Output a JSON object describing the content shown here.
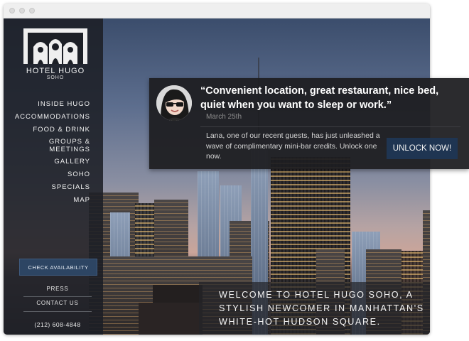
{
  "sidebar": {
    "brand": "HOTEL HUGO",
    "brand_sub": "SOHO",
    "nav": [
      {
        "label": "INSIDE HUGO"
      },
      {
        "label": "ACCOMMODATIONS"
      },
      {
        "label": "FOOD & DRINK"
      },
      {
        "label": "GROUPS &",
        "label2": "MEETINGS"
      },
      {
        "label": "GALLERY"
      },
      {
        "label": "SOHO"
      },
      {
        "label": "SPECIALS"
      },
      {
        "label": "MAP"
      }
    ],
    "cta": "CHECK AVAILABILITY",
    "press": "PRESS",
    "contact": "CONTACT US",
    "phone": "(212) 608-4848"
  },
  "welcome": {
    "line1": "WELCOME TO HOTEL HUGO SOHO, A",
    "line2": "STYLISH NEWCOMER IN MANHATTAN'S",
    "line3": "WHITE-HOT HUDSON SQUARE."
  },
  "review": {
    "quote_line1": "“Convenient location, great restaurant, nice bed,",
    "quote_line2": "quiet when you want to sleep or work.”",
    "date": "March 25th",
    "message": "Lana, one of our recent guests, has just unleashed a wave of complimentary mini-bar credits. Unlock one now.",
    "button": "UNLOCK NOW!"
  },
  "colors": {
    "sidebar_bg": "#1c1f26",
    "cta_bg": "#2d4563",
    "unlock_bg": "#1f3552"
  }
}
